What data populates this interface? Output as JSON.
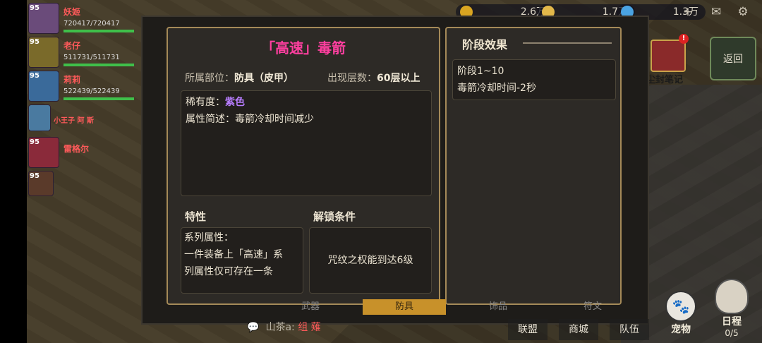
{
  "resources": [
    {
      "name": "gold",
      "value": "2.6万",
      "color": "#d9a521"
    },
    {
      "name": "coin",
      "value": "1.7万",
      "color": "#e2b84a"
    },
    {
      "name": "gem",
      "value": "1.3万",
      "color": "#4aa3e2"
    }
  ],
  "top_icons": {
    "add": "+",
    "mail": "✉",
    "settings": "⚙"
  },
  "team": [
    {
      "level": "95",
      "name": "妖姬",
      "hp": "720417/720417",
      "hp_frac": 1.0
    },
    {
      "level": "95",
      "name": "老仔",
      "hp": "511731/511731",
      "hp_frac": 1.0
    },
    {
      "level": "95",
      "name": "莉莉",
      "hp": "522439/522439",
      "hp_frac": 1.0
    },
    {
      "level": "",
      "name": "小王子 阿 斯",
      "hp": "",
      "hp_frac": null
    },
    {
      "level": "95",
      "name": "雷格尔",
      "hp": "",
      "hp_frac": null
    },
    {
      "level": "95",
      "name": "",
      "hp": "",
      "hp_frac": null
    }
  ],
  "item": {
    "title": "「高速」毒箭",
    "slot_label": "所属部位：",
    "slot_value": "防具（皮甲）",
    "floor_label": "出现层数：",
    "floor_value": "60层以上",
    "rarity_label": "稀有度：",
    "rarity_value": "紫色",
    "desc_label": "属性简述：",
    "desc_value": "毒箭冷却时间减少",
    "trait_title": "特性",
    "trait_lines": [
      "系列属性：",
      "一件装备上「高速」系",
      "列属性仅可存在一条"
    ],
    "unlock_title": "解锁条件",
    "unlock_text": "咒纹之权能到达6级"
  },
  "stage": {
    "title": "阶段效果",
    "cards": [
      {
        "range": "阶段1~10",
        "effect": "毒箭冷却时间-2秒"
      }
    ]
  },
  "side": {
    "back": "返回",
    "notebook": "尘封笔记",
    "alert": "!"
  },
  "bottom_tabs": [
    "武器",
    "防具",
    "饰品",
    "符文"
  ],
  "chat": {
    "icon": "💬",
    "sender": "山茶a:",
    "message": "组 薙"
  },
  "nav": [
    "联盟",
    "商城",
    "队伍"
  ],
  "pet": {
    "label": "宠物",
    "icon": "🐾"
  },
  "schedule": {
    "label": "日程",
    "count": "0/5"
  }
}
